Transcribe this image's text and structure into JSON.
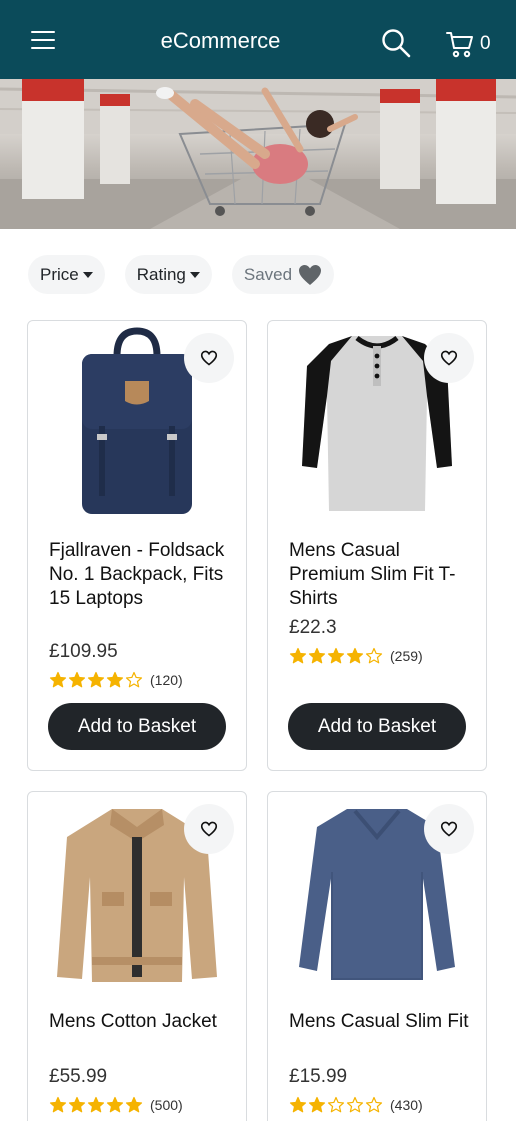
{
  "header": {
    "brand": "eCommerce",
    "cart_count": "0"
  },
  "filters": {
    "price_label": "Price",
    "rating_label": "Rating",
    "saved_label": "Saved"
  },
  "products": [
    {
      "title": "Fjallraven - Foldsack No. 1 Backpack, Fits 15 Laptops",
      "price": "£109.95",
      "rating": 3.9,
      "count": "(120)",
      "button": "Add to Basket"
    },
    {
      "title": "Mens Casual Premium Slim Fit T-Shirts",
      "price": "£22.3",
      "rating": 4.1,
      "count": "(259)",
      "button": "Add to Basket"
    },
    {
      "title": "Mens Cotton Jacket",
      "price": "£55.99",
      "rating": 4.7,
      "count": "(500)"
    },
    {
      "title": "Mens Casual Slim Fit",
      "price": "£15.99",
      "rating": 2.1,
      "count": "(430)"
    }
  ],
  "colors": {
    "nav": "#0b4b5a",
    "button": "#212529",
    "star": "#f5b301"
  }
}
